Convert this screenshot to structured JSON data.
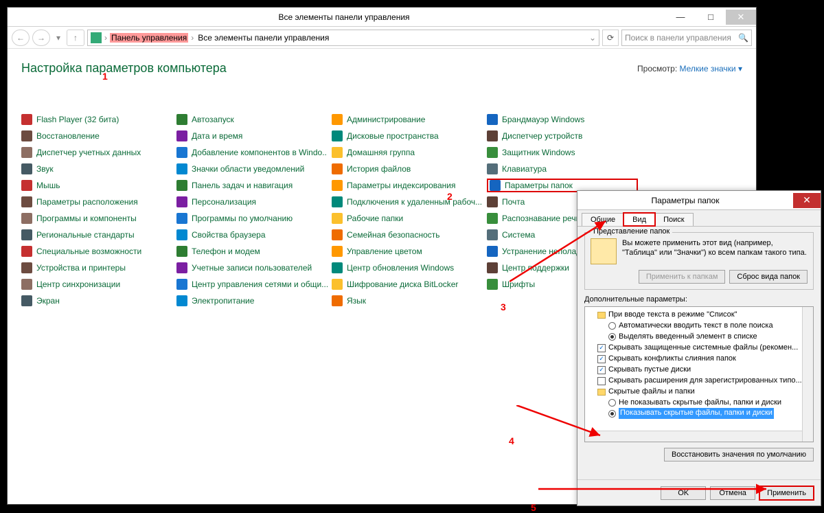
{
  "window": {
    "title": "Все элементы панели управления",
    "min": "—",
    "max": "□",
    "close": "✕"
  },
  "nav": {
    "back": "←",
    "forward": "→",
    "recent": "▾",
    "up": "↑",
    "bc_icon": "cp-icon",
    "bc1": "Панель управления",
    "sep": "›",
    "bc2": "Все элементы панели управления",
    "refresh": "⟳",
    "search_ph": "Поиск в панели управления",
    "search_icon": "🔍"
  },
  "header": {
    "title": "Настройка параметров компьютера",
    "view_label": "Просмотр:",
    "view_value": "Мелкие значки ▾"
  },
  "annotations": {
    "n1": "1",
    "n2": "2",
    "n3": "3",
    "n4": "4",
    "n5": "5"
  },
  "items": {
    "c0": [
      "Flash Player (32 бита)",
      "Восстановление",
      "Диспетчер учетных данных",
      "Звук",
      "Мышь",
      "Параметры расположения",
      "Программы и компоненты",
      "Региональные стандарты",
      "Специальные возможности",
      "Устройства и принтеры",
      "Центр синхронизации",
      "Экран"
    ],
    "c1": [
      "Автозапуск",
      "Дата и время",
      "Добавление компонентов в Windo...",
      "Значки области уведомлений",
      "Панель задач и навигация",
      "Персонализация",
      "Программы по умолчанию",
      "Свойства браузера",
      "Телефон и модем",
      "Учетные записи пользователей",
      "Центр управления сетями и общи...",
      "Электропитание"
    ],
    "c2": [
      "Администрирование",
      "Дисковые пространства",
      "Домашняя группа",
      "История файлов",
      "Параметры индексирования",
      "Подключения к удаленным рабоч...",
      "Рабочие папки",
      "Семейная безопасность",
      "Управление цветом",
      "Центр обновления Windows",
      "Шифрование диска BitLocker",
      "Язык"
    ],
    "c3": [
      "Брандмауэр Windows",
      "Диспетчер устройств",
      "Защитник Windows",
      "Клавиатура",
      "Параметры папок",
      "Почта",
      "Распознавание речи",
      "Система",
      "Устранение неполадок",
      "Центр поддержки",
      "Шрифты",
      ""
    ]
  },
  "dialog": {
    "title": "Параметры папок",
    "close": "✕",
    "tabs": {
      "t0": "Общие",
      "t1": "Вид",
      "t2": "Поиск"
    },
    "group_legend": "Представление папок",
    "group_text": "Вы можете применить этот вид (например, \"Таблица\" или \"Значки\") ко всем папкам такого типа.",
    "btn_apply_folders": "Применить к папкам",
    "btn_reset_folders": "Сброс вида папок",
    "adv_label": "Дополнительные параметры:",
    "tree": {
      "l0": "При вводе текста в режиме \"Список\"",
      "l1": "Автоматически вводить текст в поле поиска",
      "l2": "Выделять введенный элемент в списке",
      "l3": "Скрывать защищенные системные файлы (рекомен...",
      "l4": "Скрывать конфликты слияния папок",
      "l5": "Скрывать пустые диски",
      "l6": "Скрывать расширения для зарегистрированных типо...",
      "l7": "Скрытые файлы и папки",
      "l8": "Не показывать скрытые файлы, папки и диски",
      "l9": "Показывать скрытые файлы, папки и диски"
    },
    "btn_restore": "Восстановить значения по умолчанию",
    "btn_ok": "OK",
    "btn_cancel": "Отмена",
    "btn_apply": "Применить"
  }
}
